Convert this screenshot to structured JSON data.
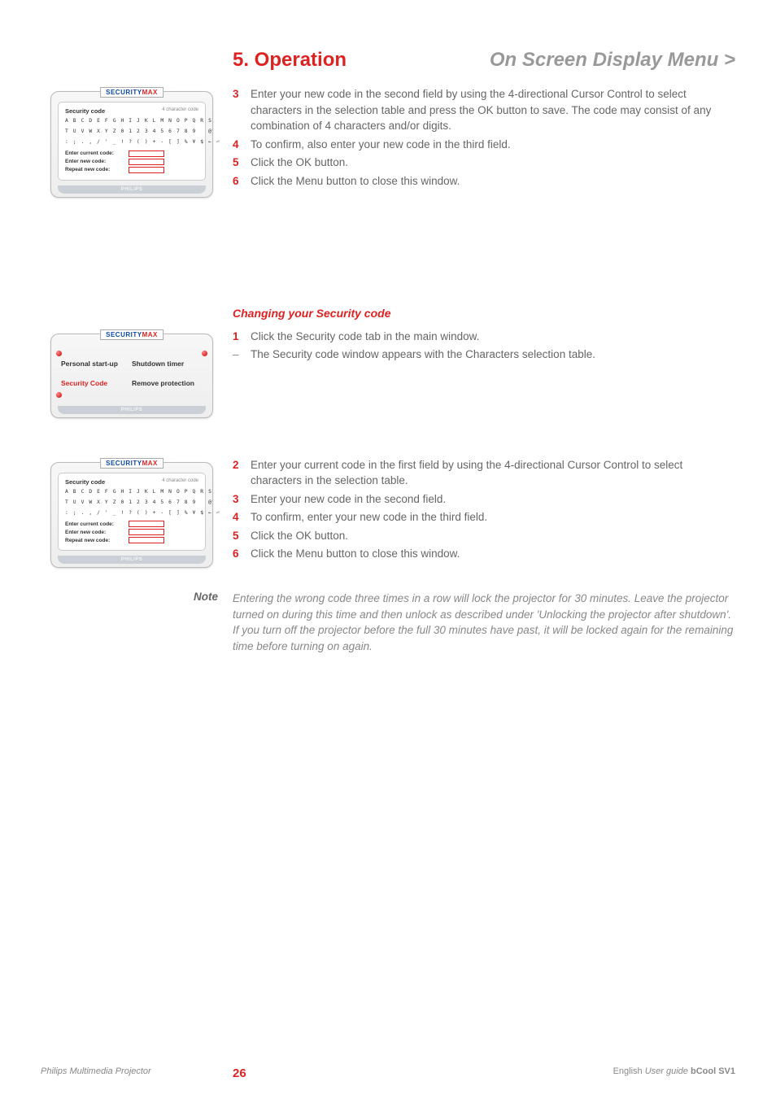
{
  "header": {
    "chapter": "5. Operation",
    "section": "On Screen Display Menu >"
  },
  "block1_steps": [
    {
      "n": "3",
      "t": "Enter your new code in the second field by using the 4-directional Cursor Control to select characters in the selection table and press the OK button to save. The code may consist of any combination of 4 characters and/or digits."
    },
    {
      "n": "4",
      "t": "To confirm, also enter your new code in the third field."
    },
    {
      "n": "5",
      "t": "Click the OK button."
    },
    {
      "n": "6",
      "t": "Click the Menu button to close this window."
    }
  ],
  "subhead": "Changing your Security code",
  "block2_steps": [
    {
      "n": "1",
      "t": "Click the Security code tab in the main window."
    },
    {
      "n": "–",
      "t": "The Security code window appears with the Characters selection table."
    }
  ],
  "block3_steps": [
    {
      "n": "2",
      "t": "Enter your current code in the first field by using the 4-directional Cursor Control to select characters in the selection table."
    },
    {
      "n": "3",
      "t": "Enter your new code in the second field."
    },
    {
      "n": "4",
      "t": "To confirm, enter your new code in the third field."
    },
    {
      "n": "5",
      "t": "Click the OK button."
    },
    {
      "n": "6",
      "t": "Click the Menu button to close this window."
    }
  ],
  "note_label": "Note",
  "note_text": "Entering the wrong code three times in a row will lock the projector for 30 minutes. Leave the projector turned on during this time and then unlock as described under 'Unlocking the projector after shutdown'. If you turn off the projector before the full 30 minutes have past, it will be locked again for the remaining time before turning on again.",
  "footer": {
    "left": "Philips Multimedia Projector",
    "page": "26",
    "lang": "English",
    "ug": "User guide",
    "model": "bCool SV1"
  },
  "osd": {
    "brand1": "SECURITY",
    "brand2": "MAX",
    "win_title": "Security code",
    "hint": "4 character code",
    "chars1": "A B C D E F G H I J K L M N O P Q R S",
    "chars2": "T U V W X Y Z 0 1 2 3 4 5 6 7 8 9   @",
    "chars3": ": ; . , / ' _ ! ? ( ) + - [ ] % ¥ $ ← ⏎",
    "f1": "Enter current code:",
    "f2": "Enter new code:",
    "f3": "Repeat new code:",
    "footer": "PHILIPS",
    "menu": {
      "a": "Personal start-up",
      "b": "Shutdown timer",
      "c": "Security Code",
      "d": "Remove protection"
    }
  }
}
